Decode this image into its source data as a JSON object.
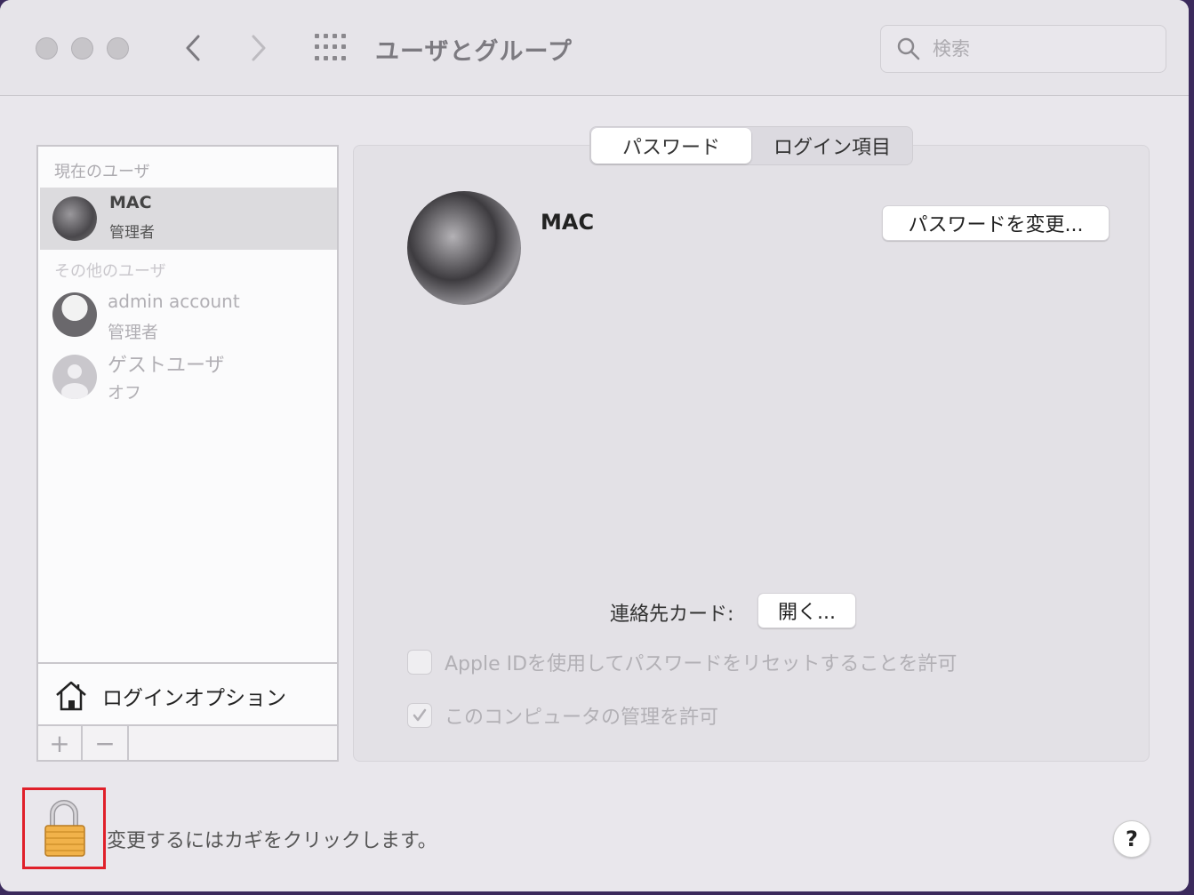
{
  "window": {
    "title": "ユーザとグループ",
    "search_placeholder": "検索"
  },
  "sidebar": {
    "current_users_label": "現在のユーザ",
    "current_user": {
      "name": "MAC",
      "role": "管理者"
    },
    "other_users_label": "その他のユーザ",
    "other_users": [
      {
        "name": "admin account",
        "role": "管理者"
      },
      {
        "name": "ゲストユーザ",
        "role": "オフ"
      }
    ],
    "login_options_label": "ログインオプション",
    "add_label": "+",
    "remove_label": "−"
  },
  "tabs": [
    {
      "label": "パスワード",
      "active": true
    },
    {
      "label": "ログイン項目",
      "active": false
    }
  ],
  "detail": {
    "user_name": "MAC",
    "change_password_label": "パスワードを変更...",
    "contact_card_label": "連絡先カード:",
    "open_label": "開く...",
    "apple_id_reset_label": "Apple IDを使用してパスワードをリセットすることを許可",
    "apple_id_reset_checked": false,
    "admin_allow_label": "このコンピュータの管理を許可",
    "admin_allow_checked": true
  },
  "footer": {
    "lock_text": "変更するにはカギをクリックします。",
    "help_label": "?"
  },
  "colors": {
    "highlight_box": "#e0202a",
    "window_bg": "#e9e7ec"
  }
}
